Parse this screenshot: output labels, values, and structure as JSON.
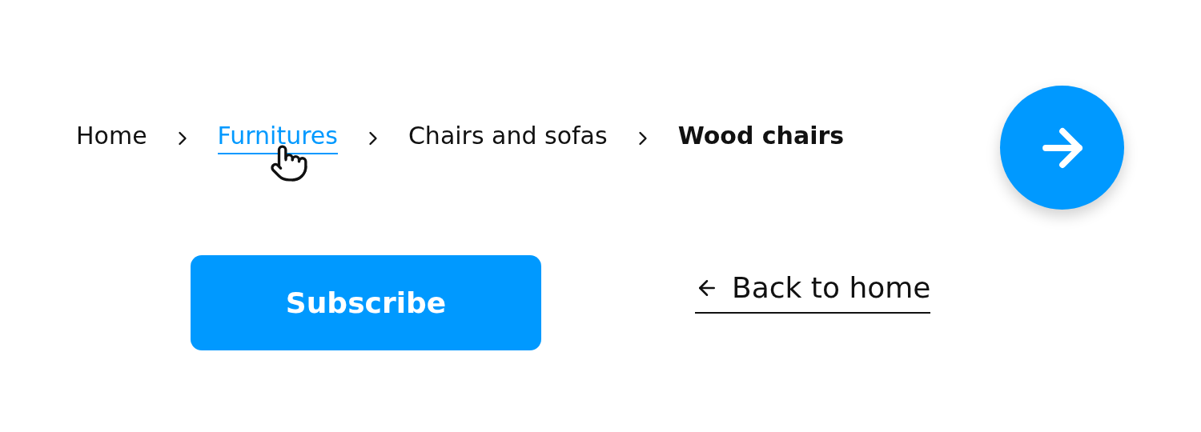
{
  "breadcrumbs": [
    {
      "label": "Home",
      "kind": "link",
      "hovered": false
    },
    {
      "label": "Furnitures",
      "kind": "link",
      "hovered": true
    },
    {
      "label": "Chairs and sofas",
      "kind": "link",
      "hovered": false
    },
    {
      "label": "Wood chairs",
      "kind": "current",
      "hovered": false
    }
  ],
  "subscribe_button": {
    "label": "Subscribe"
  },
  "back_link": {
    "label": "Back to home"
  }
}
